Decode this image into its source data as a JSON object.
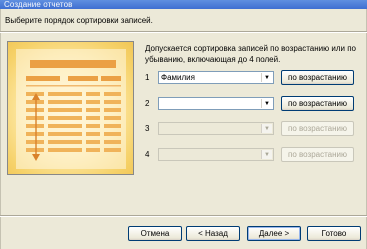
{
  "window": {
    "title": "Создание отчетов"
  },
  "instruction": "Выберите порядок сортировки записей.",
  "description": "Допускается сортировка записей по возрастанию или по убыванию, включающая до 4 полей.",
  "sort_rows": [
    {
      "number": "1",
      "field": "Фамилия",
      "order": "по возрастанию",
      "enabled": true
    },
    {
      "number": "2",
      "field": "",
      "order": "по возрастанию",
      "enabled": true
    },
    {
      "number": "3",
      "field": "",
      "order": "по возрастанию",
      "enabled": false
    },
    {
      "number": "4",
      "field": "",
      "order": "по возрастанию",
      "enabled": false
    }
  ],
  "footer": {
    "cancel": "Отмена",
    "back": "< Назад",
    "next": "Далее >",
    "finish": "Готово"
  },
  "colors": {
    "dialog_bg": "#ece9d8",
    "preview_yellow": "#f6d26a",
    "preview_orange": "#e8a33a"
  }
}
